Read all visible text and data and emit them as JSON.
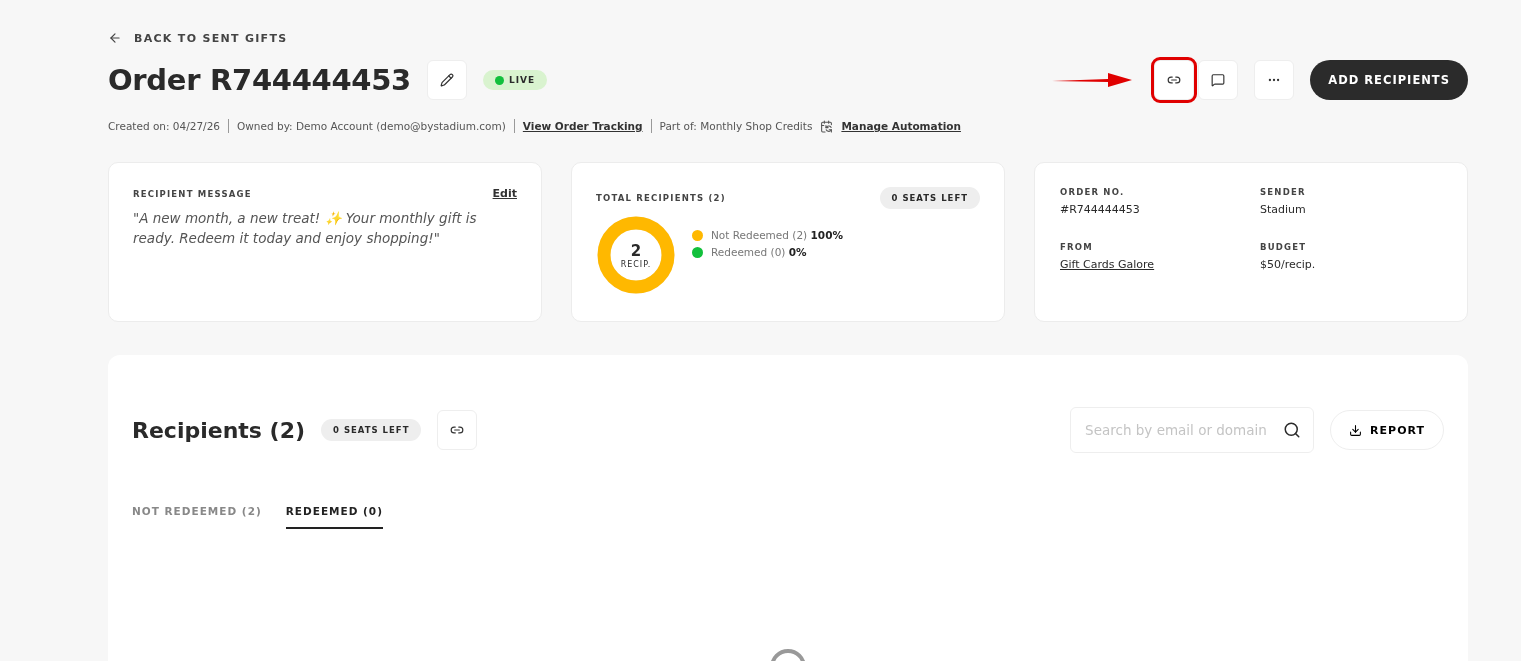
{
  "back_link": "BACK TO SENT GIFTS",
  "header": {
    "title": "Order R744444453",
    "status": "LIVE",
    "live": true
  },
  "actions": [
    {
      "kind": "link",
      "highlighted": true
    },
    {
      "kind": "comment",
      "highlighted": false
    },
    {
      "kind": "more",
      "highlighted": false
    }
  ],
  "primary_button": "ADD RECIPIENTS",
  "meta": [
    {
      "kind": "text",
      "text": "Created on: 04/27/26"
    },
    {
      "kind": "text",
      "text": "Owned by: Demo Account (demo@bystadium.com)"
    },
    {
      "kind": "link",
      "text": "View Order Tracking"
    },
    {
      "kind": "automation",
      "text": "Part of: Monthly Shop Credits",
      "link": "Manage Automation"
    }
  ],
  "message_card": {
    "label": "RECIPIENT MESSAGE",
    "edit": "Edit",
    "message": "\"A new month, a new treat! ✨ Your monthly gift is ready. Redeem it today and enjoy shopping!\""
  },
  "recipients_card": {
    "label": "TOTAL RECIPIENTS (2)",
    "badge": "0 SEATS LEFT",
    "count": "2",
    "unit": "RECIP.",
    "legend": [
      {
        "label": "Not Redeemed (2)",
        "percent": "100%",
        "color": "#ffb800",
        "level": 1
      },
      {
        "label": "Redeemed (0)",
        "percent": "0%",
        "color": "#12c03c",
        "level": 0
      }
    ]
  },
  "details_card": [
    {
      "label": "ORDER NO.",
      "value": "#R744444453",
      "link": false
    },
    {
      "label": "SENDER",
      "value": "Stadium",
      "link": false
    },
    {
      "label": "FROM",
      "value": "Gift Cards Galore",
      "link": true
    },
    {
      "label": "BUDGET",
      "value": "$50/recip.",
      "link": false
    }
  ],
  "recipients_panel": {
    "title": "Recipients (2)",
    "badge": "0 SEATS LEFT",
    "search": {
      "placeholder": "Search by email or domain"
    },
    "report": "REPORT",
    "tabs": [
      {
        "label": "NOT REDEEMED (2)",
        "selected": false
      },
      {
        "label": "REDEEMED (0)",
        "selected": true
      }
    ],
    "loading": true
  }
}
